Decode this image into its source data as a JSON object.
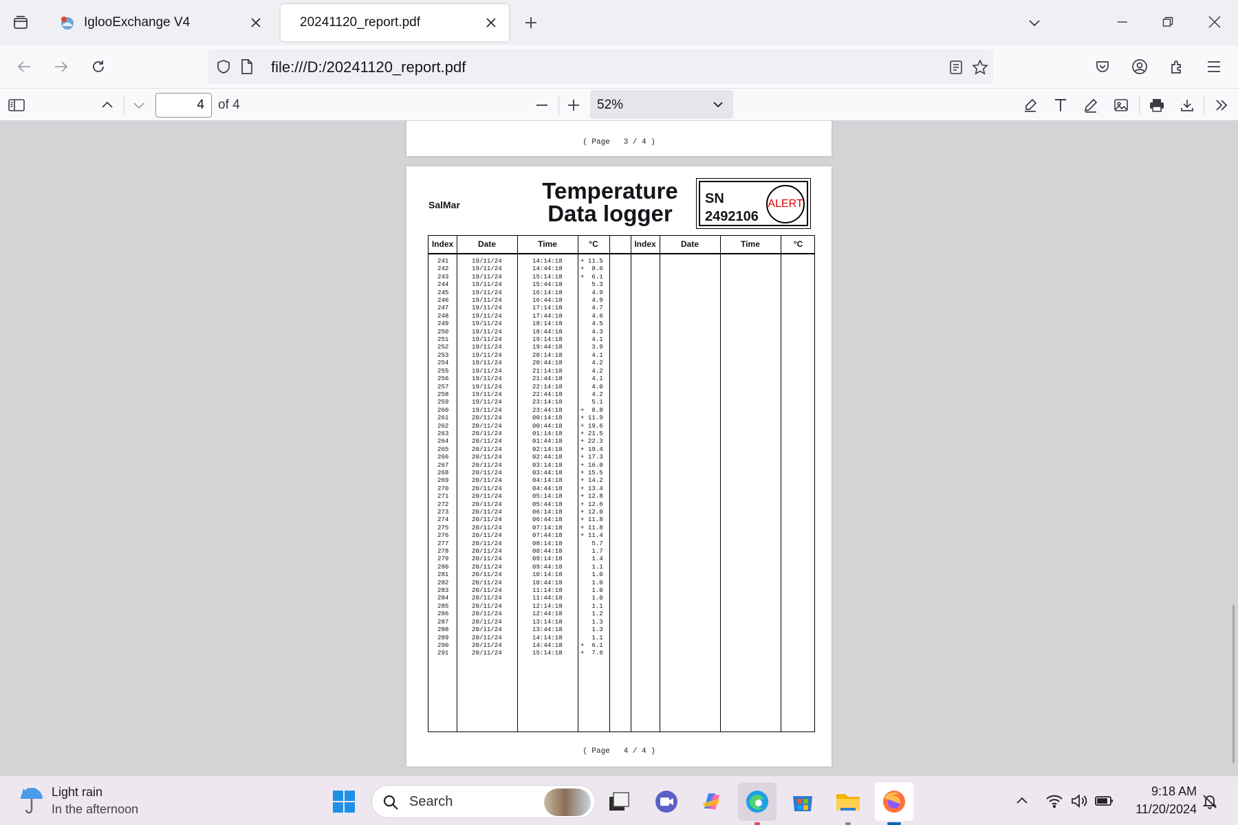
{
  "tabs": [
    {
      "label": "IglooExchange V4",
      "active": false
    },
    {
      "label": "20241120_report.pdf",
      "active": true
    }
  ],
  "nav": {
    "url": "file:///D:/20241120_report.pdf"
  },
  "pdf_toolbar": {
    "page_number": "4",
    "page_count_label": "of 4",
    "zoom": "52%"
  },
  "page3": {
    "footer": "( Page   3 / 4 )"
  },
  "page4": {
    "company": "SalMar",
    "title_line1": "Temperature",
    "title_line2": "Data logger",
    "sn_label": "SN",
    "serial_number": "2492106",
    "alert": "ALERT",
    "footer": "( Page   4 / 4 )",
    "headers": [
      "Index",
      "Date",
      "Time",
      "°C",
      "Index",
      "Date",
      "Time",
      "°C"
    ],
    "indices": [
      "241",
      "242",
      "243",
      "244",
      "245",
      "246",
      "247",
      "248",
      "249",
      "250",
      "251",
      "252",
      "253",
      "254",
      "255",
      "256",
      "257",
      "258",
      "259",
      "260",
      "261",
      "262",
      "263",
      "264",
      "265",
      "266",
      "267",
      "268",
      "269",
      "270",
      "271",
      "272",
      "273",
      "274",
      "275",
      "276",
      "277",
      "278",
      "279",
      "280",
      "281",
      "282",
      "283",
      "284",
      "285",
      "286",
      "287",
      "288",
      "289",
      "290",
      "291"
    ],
    "dates": [
      "19/11/24",
      "19/11/24",
      "19/11/24",
      "19/11/24",
      "19/11/24",
      "19/11/24",
      "19/11/24",
      "19/11/24",
      "19/11/24",
      "19/11/24",
      "19/11/24",
      "19/11/24",
      "19/11/24",
      "19/11/24",
      "19/11/24",
      "19/11/24",
      "19/11/24",
      "19/11/24",
      "19/11/24",
      "19/11/24",
      "20/11/24",
      "20/11/24",
      "20/11/24",
      "20/11/24",
      "20/11/24",
      "20/11/24",
      "20/11/24",
      "20/11/24",
      "20/11/24",
      "20/11/24",
      "20/11/24",
      "20/11/24",
      "20/11/24",
      "20/11/24",
      "20/11/24",
      "20/11/24",
      "20/11/24",
      "20/11/24",
      "20/11/24",
      "20/11/24",
      "20/11/24",
      "20/11/24",
      "20/11/24",
      "20/11/24",
      "20/11/24",
      "20/11/24",
      "20/11/24",
      "20/11/24",
      "20/11/24",
      "20/11/24",
      "20/11/24"
    ],
    "times": [
      "14:14:18",
      "14:44:18",
      "15:14:18",
      "15:44:18",
      "16:14:18",
      "16:44:18",
      "17:14:18",
      "17:44:18",
      "18:14:18",
      "18:44:18",
      "19:14:18",
      "19:44:18",
      "20:14:18",
      "20:44:18",
      "21:14:18",
      "21:44:18",
      "22:14:18",
      "22:44:18",
      "23:14:18",
      "23:44:18",
      "00:14:18",
      "00:44:18",
      "01:14:18",
      "01:44:18",
      "02:14:18",
      "02:44:18",
      "03:14:18",
      "03:44:18",
      "04:14:18",
      "04:44:18",
      "05:14:18",
      "05:44:18",
      "06:14:18",
      "06:44:18",
      "07:14:18",
      "07:44:18",
      "08:14:18",
      "08:44:18",
      "09:14:18",
      "09:44:18",
      "10:14:18",
      "10:44:18",
      "11:14:18",
      "11:44:18",
      "12:14:18",
      "12:44:18",
      "13:14:18",
      "13:44:18",
      "14:14:18",
      "14:44:18",
      "15:14:18"
    ],
    "temps": [
      "+ 11.5",
      "+  8.6",
      "+  6.1",
      "   5.3",
      "   4.9",
      "   4.9",
      "   4.7",
      "   4.6",
      "   4.5",
      "   4.3",
      "   4.1",
      "   3.9",
      "   4.1",
      "   4.2",
      "   4.2",
      "   4.1",
      "   4.0",
      "   4.2",
      "   5.1",
      "+  8.8",
      "+ 11.9",
      "+ 19.6",
      "+ 21.5",
      "+ 22.3",
      "+ 19.4",
      "+ 17.3",
      "+ 16.0",
      "+ 15.5",
      "+ 14.2",
      "+ 13.4",
      "+ 12.8",
      "+ 12.6",
      "+ 12.0",
      "+ 11.8",
      "+ 11.8",
      "+ 11.4",
      "   5.7",
      "   1.7",
      "   1.4",
      "   1.1",
      "   1.0",
      "   1.0",
      "   1.0",
      "   1.0",
      "   1.1",
      "   1.2",
      "   1.3",
      "   1.3",
      "   1.1",
      "+  6.1",
      "+  7.6"
    ]
  },
  "taskbar": {
    "weather_title": "Light rain",
    "weather_sub": "In the afternoon",
    "search_placeholder": "Search",
    "time": "9:18 AM",
    "date": "11/20/2024"
  },
  "colors": {
    "alert": "#e00000",
    "viewer_bg": "#d4d4d7",
    "firefox_orange": "#ff7139",
    "active_indicator": "#0067c0"
  }
}
